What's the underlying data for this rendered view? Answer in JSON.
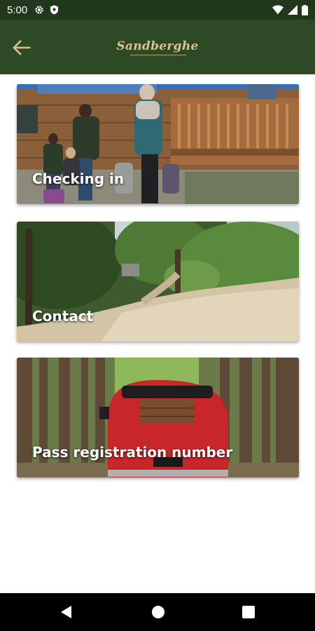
{
  "status_bar": {
    "time": "5:00",
    "left_icons": [
      "gear-icon",
      "shield-icon"
    ],
    "right_icons": [
      "wifi-icon",
      "signal-icon",
      "battery-icon"
    ]
  },
  "app_bar": {
    "logo_text": "Sandberghe",
    "background": "#2d4a25",
    "accent": "#d9c28a"
  },
  "cards": [
    {
      "label": "Checking in",
      "image": "family-with-luggage-at-wooden-lodge"
    },
    {
      "label": "Contact",
      "image": "sandy-forest-path"
    },
    {
      "label": "Pass registration number",
      "image": "red-vintage-car-in-forest"
    }
  ],
  "nav_bar": {
    "buttons": [
      "back-triangle-icon",
      "home-circle-icon",
      "recents-square-icon"
    ]
  }
}
